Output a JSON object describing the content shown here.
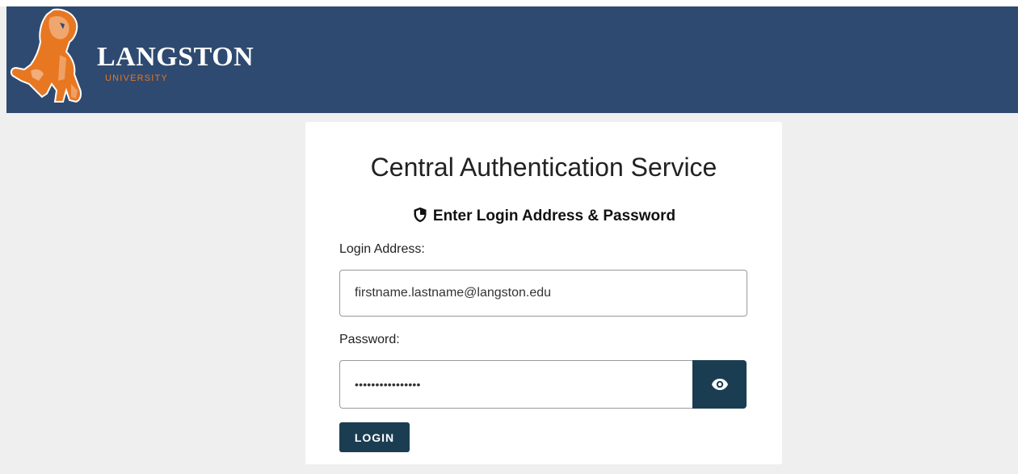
{
  "header": {
    "logo_name": "LANGSTON",
    "logo_subtitle": "UNIVERSITY",
    "background_color": "#2e4a70",
    "accent_color": "#e87722",
    "logo_icon": "lion-mascot-icon"
  },
  "card": {
    "title": "Central Authentication Service",
    "subtitle": "Enter Login Address & Password",
    "subtitle_icon": "shield-icon"
  },
  "form": {
    "login_label": "Login Address:",
    "login_value": "firstname.lastname@langston.edu",
    "password_label": "Password:",
    "password_value": "••••••••••••••••",
    "toggle_icon": "eye-icon",
    "login_button_label": "LOGIN",
    "button_color": "#1b3d52"
  }
}
